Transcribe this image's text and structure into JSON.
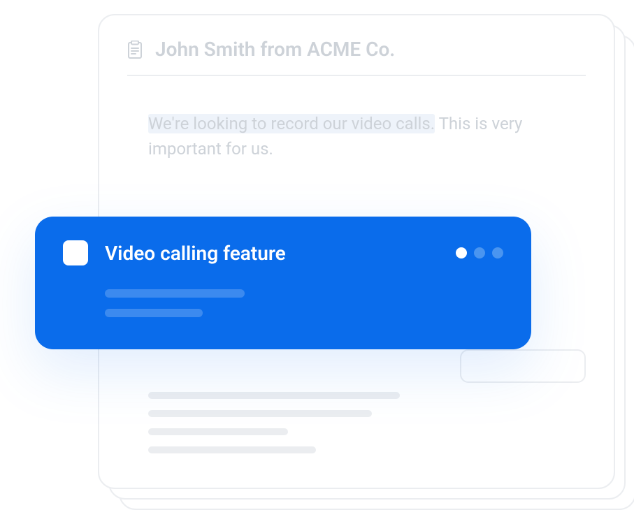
{
  "card": {
    "title": "John Smith from ACME Co.",
    "body_highlighted": "We're looking to record our video calls.",
    "body_rest": " This is very important for us."
  },
  "feature": {
    "title": "Video calling feature"
  }
}
